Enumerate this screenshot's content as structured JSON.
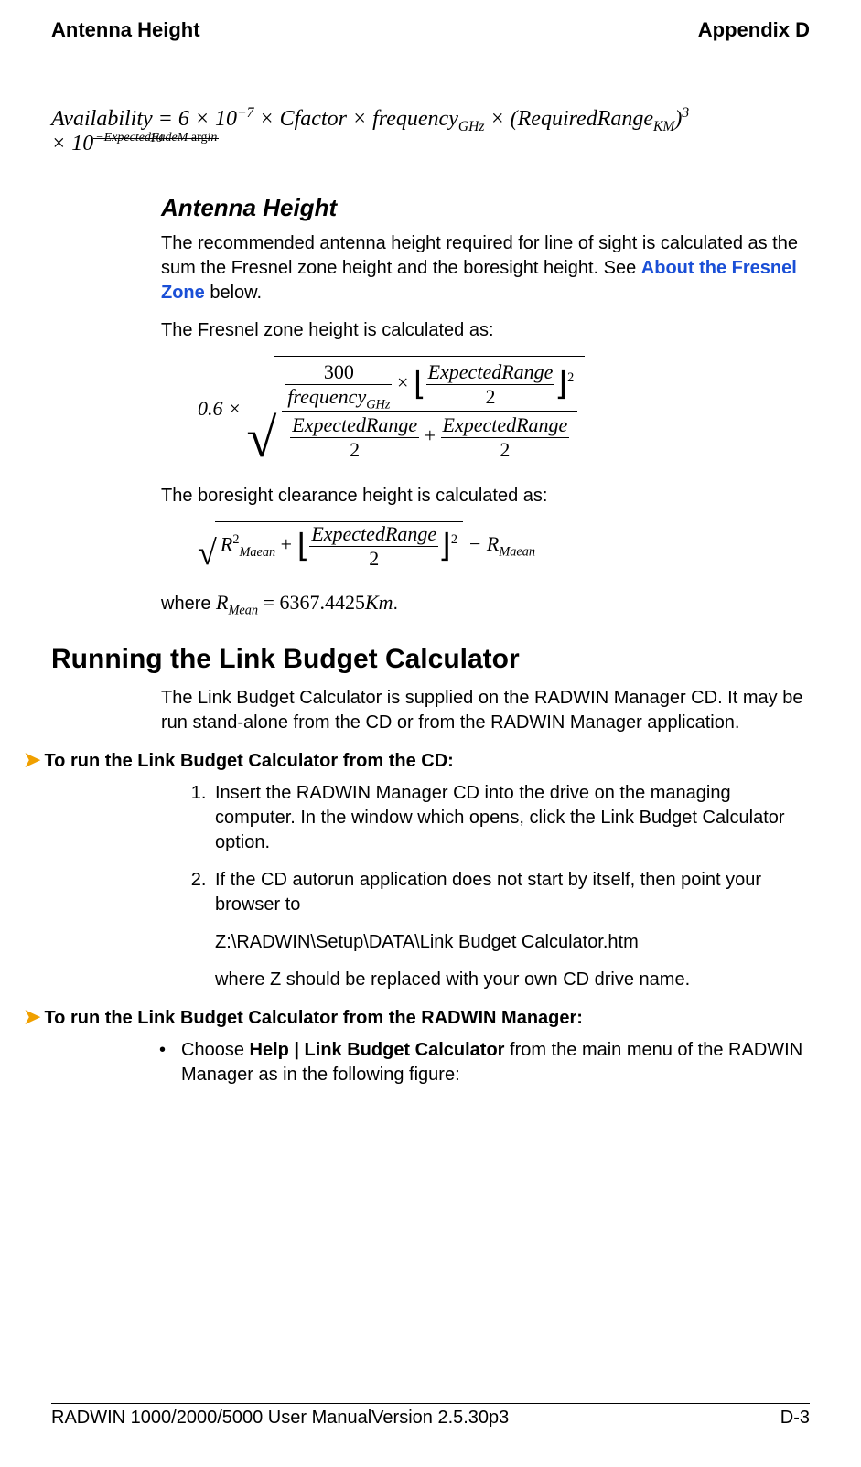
{
  "header": {
    "left": "Antenna Height",
    "right": "Appendix D"
  },
  "eq_avail": {
    "lhs": "Availability",
    "eq": " = ",
    "c1": "6 × 10",
    "exp1": "−7",
    "c2": " × Cfactor × frequency",
    "sub_ghz": "GHz",
    "c3": " × (RequiredRange",
    "sub_km": "KM",
    "c4": ")",
    "exp3": "3",
    "line2_pre": "× 10",
    "exp2_num": "−ExpectedFadeM",
    "exp2_num_rom": " arg",
    "exp2_num2": "in",
    "exp2_den": "10"
  },
  "antenna_heading": "Antenna Height",
  "antenna_p1_a": "The recommended antenna height required for line of sight is calculated as the sum the Fresnel zone height and the boresight height. See ",
  "antenna_p1_link": "About the Fresnel Zone",
  "antenna_p1_b": " below.",
  "fresnel_intro": "The Fresnel zone height is calculated as:",
  "fresnel_eq": {
    "pre": "0.6 × ",
    "num_top_300": "300",
    "num_top_freq": "frequency",
    "num_top_sub": "GHz",
    "er": "ExpectedRange",
    "two": "2",
    "plus": "+"
  },
  "boresight_intro": "The boresight clearance height is calculated as:",
  "boresight_eq": {
    "R2": "R",
    "exp2": "2",
    "sub_maean": "Maean",
    "plus": "+",
    "er": "ExpectedRange",
    "two": "2",
    "minus": "− R"
  },
  "where_pre": "where ",
  "where_sym": "R",
  "where_sub": "Mean",
  "where_eq": " = ",
  "where_val": "6367.4425",
  "where_unit": "Km",
  "where_post": ".",
  "main_heading": "Running the Link Budget Calculator",
  "main_p1": "The Link Budget Calculator is supplied on the RADWIN Manager CD. It may be run stand-alone from the CD or from the RADWIN Manager application.",
  "runcd_heading": "To run the Link Budget Calculator from the CD:",
  "steps_cd": {
    "s1": "Insert the RADWIN Manager CD into the drive on the managing computer. In the window which opens, click the Link Budget Calculator option.",
    "s2a": "If the CD autorun application does not start by itself, then point your browser to",
    "s2b": "Z:\\RADWIN\\Setup\\DATA\\Link Budget Calculator.htm",
    "s2c": "where Z should be replaced with your own CD drive name."
  },
  "runmgr_heading": "To run the Link Budget Calculator from the RADWIN Manager:",
  "bullet_mgr_a": "Choose ",
  "bullet_mgr_b": "Help | Link Budget Calculator",
  "bullet_mgr_c": " from the main menu of the RADWIN Manager as in the following figure:",
  "footer": {
    "left": "RADWIN 1000/2000/5000 User ManualVersion  2.5.30p3",
    "right": "D-3"
  }
}
